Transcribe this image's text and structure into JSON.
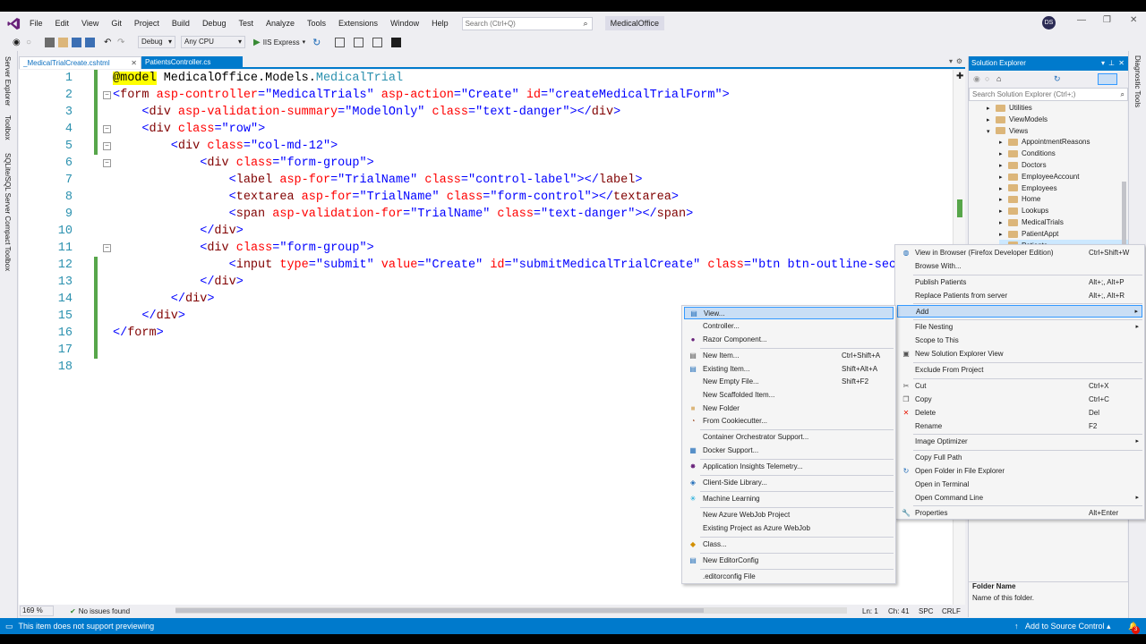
{
  "menubar": {
    "items": [
      "File",
      "Edit",
      "View",
      "Git",
      "Project",
      "Build",
      "Debug",
      "Test",
      "Analyze",
      "Tools",
      "Extensions",
      "Window",
      "Help"
    ],
    "search_placeholder": "Search (Ctrl+Q)",
    "solution_name": "MedicalOffice",
    "avatar_initials": "DS"
  },
  "toolbar": {
    "config": "Debug",
    "platform": "Any CPU",
    "run_target": "IIS Express"
  },
  "left_strip": [
    "Server Explorer",
    "Toolbox",
    "SQLite/SQL Server Compact Toolbox"
  ],
  "tabs": {
    "active": "_MedicalTrialCreate.cshtml",
    "second": "PatientsController.cs"
  },
  "code": {
    "line_numbers": [
      "1",
      "2",
      "3",
      "4",
      "5",
      "6",
      "7",
      "8",
      "9",
      "10",
      "11",
      "12",
      "13",
      "14",
      "15",
      "16",
      "17",
      "18"
    ],
    "lines": [
      [
        {
          "t": "@model",
          "c": "k-model"
        },
        {
          "t": " MedicalOffice.Models.",
          "c": "k-txt"
        },
        {
          "t": "MedicalTrial",
          "c": "k-cls"
        }
      ],
      [
        {
          "t": "<",
          "c": "k-val"
        },
        {
          "t": "form",
          "c": "k-tag"
        },
        {
          "t": " asp-controller",
          "c": "k-attr"
        },
        {
          "t": "=",
          "c": "k-val"
        },
        {
          "t": "\"MedicalTrials\"",
          "c": "k-val"
        },
        {
          "t": " asp-action",
          "c": "k-attr"
        },
        {
          "t": "=",
          "c": "k-val"
        },
        {
          "t": "\"Create\"",
          "c": "k-val"
        },
        {
          "t": " id",
          "c": "k-attr"
        },
        {
          "t": "=",
          "c": "k-val"
        },
        {
          "t": "\"createMedicalTrialForm\"",
          "c": "k-val"
        },
        {
          "t": ">",
          "c": "k-val"
        }
      ],
      [
        {
          "t": "    <",
          "c": "k-val"
        },
        {
          "t": "div",
          "c": "k-tag"
        },
        {
          "t": " asp-validation-summary",
          "c": "k-attr"
        },
        {
          "t": "=",
          "c": "k-val"
        },
        {
          "t": "\"ModelOnly\"",
          "c": "k-val"
        },
        {
          "t": " class",
          "c": "k-attr"
        },
        {
          "t": "=",
          "c": "k-val"
        },
        {
          "t": "\"text-danger\"",
          "c": "k-val"
        },
        {
          "t": "></",
          "c": "k-val"
        },
        {
          "t": "div",
          "c": "k-tag"
        },
        {
          "t": ">",
          "c": "k-val"
        }
      ],
      [
        {
          "t": "    <",
          "c": "k-val"
        },
        {
          "t": "div",
          "c": "k-tag"
        },
        {
          "t": " class",
          "c": "k-attr"
        },
        {
          "t": "=",
          "c": "k-val"
        },
        {
          "t": "\"row\"",
          "c": "k-val"
        },
        {
          "t": ">",
          "c": "k-val"
        }
      ],
      [
        {
          "t": "        <",
          "c": "k-val"
        },
        {
          "t": "div",
          "c": "k-tag"
        },
        {
          "t": " class",
          "c": "k-attr"
        },
        {
          "t": "=",
          "c": "k-val"
        },
        {
          "t": "\"col-md-12\"",
          "c": "k-val"
        },
        {
          "t": ">",
          "c": "k-val"
        }
      ],
      [
        {
          "t": "            <",
          "c": "k-val"
        },
        {
          "t": "div",
          "c": "k-tag"
        },
        {
          "t": " class",
          "c": "k-attr"
        },
        {
          "t": "=",
          "c": "k-val"
        },
        {
          "t": "\"form-group\"",
          "c": "k-val"
        },
        {
          "t": ">",
          "c": "k-val"
        }
      ],
      [
        {
          "t": "                <",
          "c": "k-val"
        },
        {
          "t": "label",
          "c": "k-tag"
        },
        {
          "t": " asp-for",
          "c": "k-attr"
        },
        {
          "t": "=",
          "c": "k-val"
        },
        {
          "t": "\"TrialName\"",
          "c": "k-val"
        },
        {
          "t": " class",
          "c": "k-attr"
        },
        {
          "t": "=",
          "c": "k-val"
        },
        {
          "t": "\"control-label\"",
          "c": "k-val"
        },
        {
          "t": "></",
          "c": "k-val"
        },
        {
          "t": "label",
          "c": "k-tag"
        },
        {
          "t": ">",
          "c": "k-val"
        }
      ],
      [
        {
          "t": "                <",
          "c": "k-val"
        },
        {
          "t": "textarea",
          "c": "k-tag"
        },
        {
          "t": " asp-for",
          "c": "k-attr"
        },
        {
          "t": "=",
          "c": "k-val"
        },
        {
          "t": "\"TrialName\"",
          "c": "k-val"
        },
        {
          "t": " class",
          "c": "k-attr"
        },
        {
          "t": "=",
          "c": "k-val"
        },
        {
          "t": "\"form-control\"",
          "c": "k-val"
        },
        {
          "t": "></",
          "c": "k-val"
        },
        {
          "t": "textarea",
          "c": "k-tag"
        },
        {
          "t": ">",
          "c": "k-val"
        }
      ],
      [
        {
          "t": "                <",
          "c": "k-val"
        },
        {
          "t": "span",
          "c": "k-tag"
        },
        {
          "t": " asp-validation-for",
          "c": "k-attr"
        },
        {
          "t": "=",
          "c": "k-val"
        },
        {
          "t": "\"TrialName\"",
          "c": "k-val"
        },
        {
          "t": " class",
          "c": "k-attr"
        },
        {
          "t": "=",
          "c": "k-val"
        },
        {
          "t": "\"text-danger\"",
          "c": "k-val"
        },
        {
          "t": "></",
          "c": "k-val"
        },
        {
          "t": "span",
          "c": "k-tag"
        },
        {
          "t": ">",
          "c": "k-val"
        }
      ],
      [
        {
          "t": "            </",
          "c": "k-val"
        },
        {
          "t": "div",
          "c": "k-tag"
        },
        {
          "t": ">",
          "c": "k-val"
        }
      ],
      [
        {
          "t": "            <",
          "c": "k-val"
        },
        {
          "t": "div",
          "c": "k-tag"
        },
        {
          "t": " class",
          "c": "k-attr"
        },
        {
          "t": "=",
          "c": "k-val"
        },
        {
          "t": "\"form-group\"",
          "c": "k-val"
        },
        {
          "t": ">",
          "c": "k-val"
        }
      ],
      [
        {
          "t": "                <",
          "c": "k-val"
        },
        {
          "t": "input",
          "c": "k-tag"
        },
        {
          "t": " type",
          "c": "k-attr"
        },
        {
          "t": "=",
          "c": "k-val"
        },
        {
          "t": "\"submit\"",
          "c": "k-val"
        },
        {
          "t": " value",
          "c": "k-attr"
        },
        {
          "t": "=",
          "c": "k-val"
        },
        {
          "t": "\"Create\"",
          "c": "k-val"
        },
        {
          "t": " id",
          "c": "k-attr"
        },
        {
          "t": "=",
          "c": "k-val"
        },
        {
          "t": "\"submitMedicalTrialCreate\"",
          "c": "k-val"
        },
        {
          "t": " class",
          "c": "k-attr"
        },
        {
          "t": "=",
          "c": "k-val"
        },
        {
          "t": "\"btn btn-outline-sec",
          "c": "k-val"
        }
      ],
      [
        {
          "t": "            </",
          "c": "k-val"
        },
        {
          "t": "div",
          "c": "k-tag"
        },
        {
          "t": ">",
          "c": "k-val"
        }
      ],
      [
        {
          "t": "        </",
          "c": "k-val"
        },
        {
          "t": "div",
          "c": "k-tag"
        },
        {
          "t": ">",
          "c": "k-val"
        }
      ],
      [
        {
          "t": "    </",
          "c": "k-val"
        },
        {
          "t": "div",
          "c": "k-tag"
        },
        {
          "t": ">",
          "c": "k-val"
        }
      ],
      [
        {
          "t": "</",
          "c": "k-val"
        },
        {
          "t": "form",
          "c": "k-tag"
        },
        {
          "t": ">",
          "c": "k-val"
        }
      ],
      [],
      []
    ]
  },
  "editor_status": {
    "zoom": "169 %",
    "issues": "No issues found",
    "ln": "Ln: 1",
    "ch": "Ch: 41",
    "spc": "SPC",
    "crlf": "CRLF"
  },
  "status_bar": {
    "message": "This item does not support previewing",
    "source_control": "Add to Source Control",
    "notif_count": "3"
  },
  "solution_explorer": {
    "title": "Solution Explorer",
    "search_placeholder": "Search Solution Explorer (Ctrl+;)",
    "items": [
      "Utilities",
      "ViewModels",
      "Views",
      "AppointmentReasons",
      "Conditions",
      "Doctors",
      "EmployeeAccount",
      "Employees",
      "Home",
      "Lookups",
      "MedicalTrials",
      "PatientAppt",
      "Patients"
    ],
    "props_title": "Folder Name",
    "props_desc": "Name of this folder."
  },
  "right_strip": "Diagnostic Tools",
  "context_main": [
    {
      "label": "View in Browser (Firefox Developer Edition)",
      "shortcut": "Ctrl+Shift+W",
      "icon": "globe-icon"
    },
    {
      "label": "Browse With...",
      "shortcut": "",
      "icon": ""
    },
    {
      "label": "Publish Patients",
      "shortcut": "Alt+;, Alt+P",
      "icon": ""
    },
    {
      "label": "Replace Patients from server",
      "shortcut": "Alt+;, Alt+R",
      "icon": ""
    },
    {
      "label": "Add",
      "shortcut": "",
      "icon": "",
      "sub": true
    },
    {
      "label": "File Nesting",
      "shortcut": "",
      "icon": "",
      "sub": true
    },
    {
      "label": "Scope to This",
      "shortcut": "",
      "icon": ""
    },
    {
      "label": "New Solution Explorer View",
      "shortcut": "",
      "icon": "window-icon"
    },
    {
      "label": "Exclude From Project",
      "shortcut": "",
      "icon": ""
    },
    {
      "label": "Cut",
      "shortcut": "Ctrl+X",
      "icon": "scissors-icon"
    },
    {
      "label": "Copy",
      "shortcut": "Ctrl+C",
      "icon": "copy-icon"
    },
    {
      "label": "Delete",
      "shortcut": "Del",
      "icon": "delete-icon"
    },
    {
      "label": "Rename",
      "shortcut": "F2",
      "icon": ""
    },
    {
      "label": "Image Optimizer",
      "shortcut": "",
      "icon": "",
      "sub": true
    },
    {
      "label": "Copy Full Path",
      "shortcut": "",
      "icon": ""
    },
    {
      "label": "Open Folder in File Explorer",
      "shortcut": "",
      "icon": "refresh-icon"
    },
    {
      "label": "Open in Terminal",
      "shortcut": "",
      "icon": ""
    },
    {
      "label": "Open Command Line",
      "shortcut": "",
      "icon": "",
      "sub": true
    },
    {
      "label": "Properties",
      "shortcut": "Alt+Enter",
      "icon": "wrench-icon"
    }
  ],
  "context_add": [
    {
      "label": "View...",
      "shortcut": "",
      "icon": "page-icon"
    },
    {
      "label": "Controller...",
      "shortcut": "",
      "icon": ""
    },
    {
      "label": "Razor Component...",
      "shortcut": "",
      "icon": "razor-icon"
    },
    {
      "label": "New Item...",
      "shortcut": "Ctrl+Shift+A",
      "icon": "new-item-icon"
    },
    {
      "label": "Existing Item...",
      "shortcut": "Shift+Alt+A",
      "icon": "existing-item-icon"
    },
    {
      "label": "New Empty File...",
      "shortcut": "Shift+F2",
      "icon": ""
    },
    {
      "label": "New Scaffolded Item...",
      "shortcut": "",
      "icon": ""
    },
    {
      "label": "New Folder",
      "shortcut": "",
      "icon": "folder-icon"
    },
    {
      "label": "From Cookiecutter...",
      "shortcut": "",
      "icon": "cookie-icon"
    },
    {
      "label": "Container Orchestrator Support...",
      "shortcut": "",
      "icon": ""
    },
    {
      "label": "Docker Support...",
      "shortcut": "",
      "icon": "docker-icon"
    },
    {
      "label": "Application Insights Telemetry...",
      "shortcut": "",
      "icon": "insights-icon"
    },
    {
      "label": "Client-Side Library...",
      "shortcut": "",
      "icon": "library-icon"
    },
    {
      "label": "Machine Learning",
      "shortcut": "",
      "icon": "ml-icon"
    },
    {
      "label": "New Azure WebJob Project",
      "shortcut": "",
      "icon": ""
    },
    {
      "label": "Existing Project as Azure WebJob",
      "shortcut": "",
      "icon": ""
    },
    {
      "label": "Class...",
      "shortcut": "",
      "icon": "class-icon"
    },
    {
      "label": "New EditorConfig",
      "shortcut": "",
      "icon": "editorconfig-icon"
    },
    {
      "label": ".editorconfig File",
      "shortcut": "",
      "icon": ""
    }
  ],
  "colors": {
    "accent": "#007acc",
    "chrome": "#eeeef2",
    "gutter_change": "#57a64a"
  }
}
